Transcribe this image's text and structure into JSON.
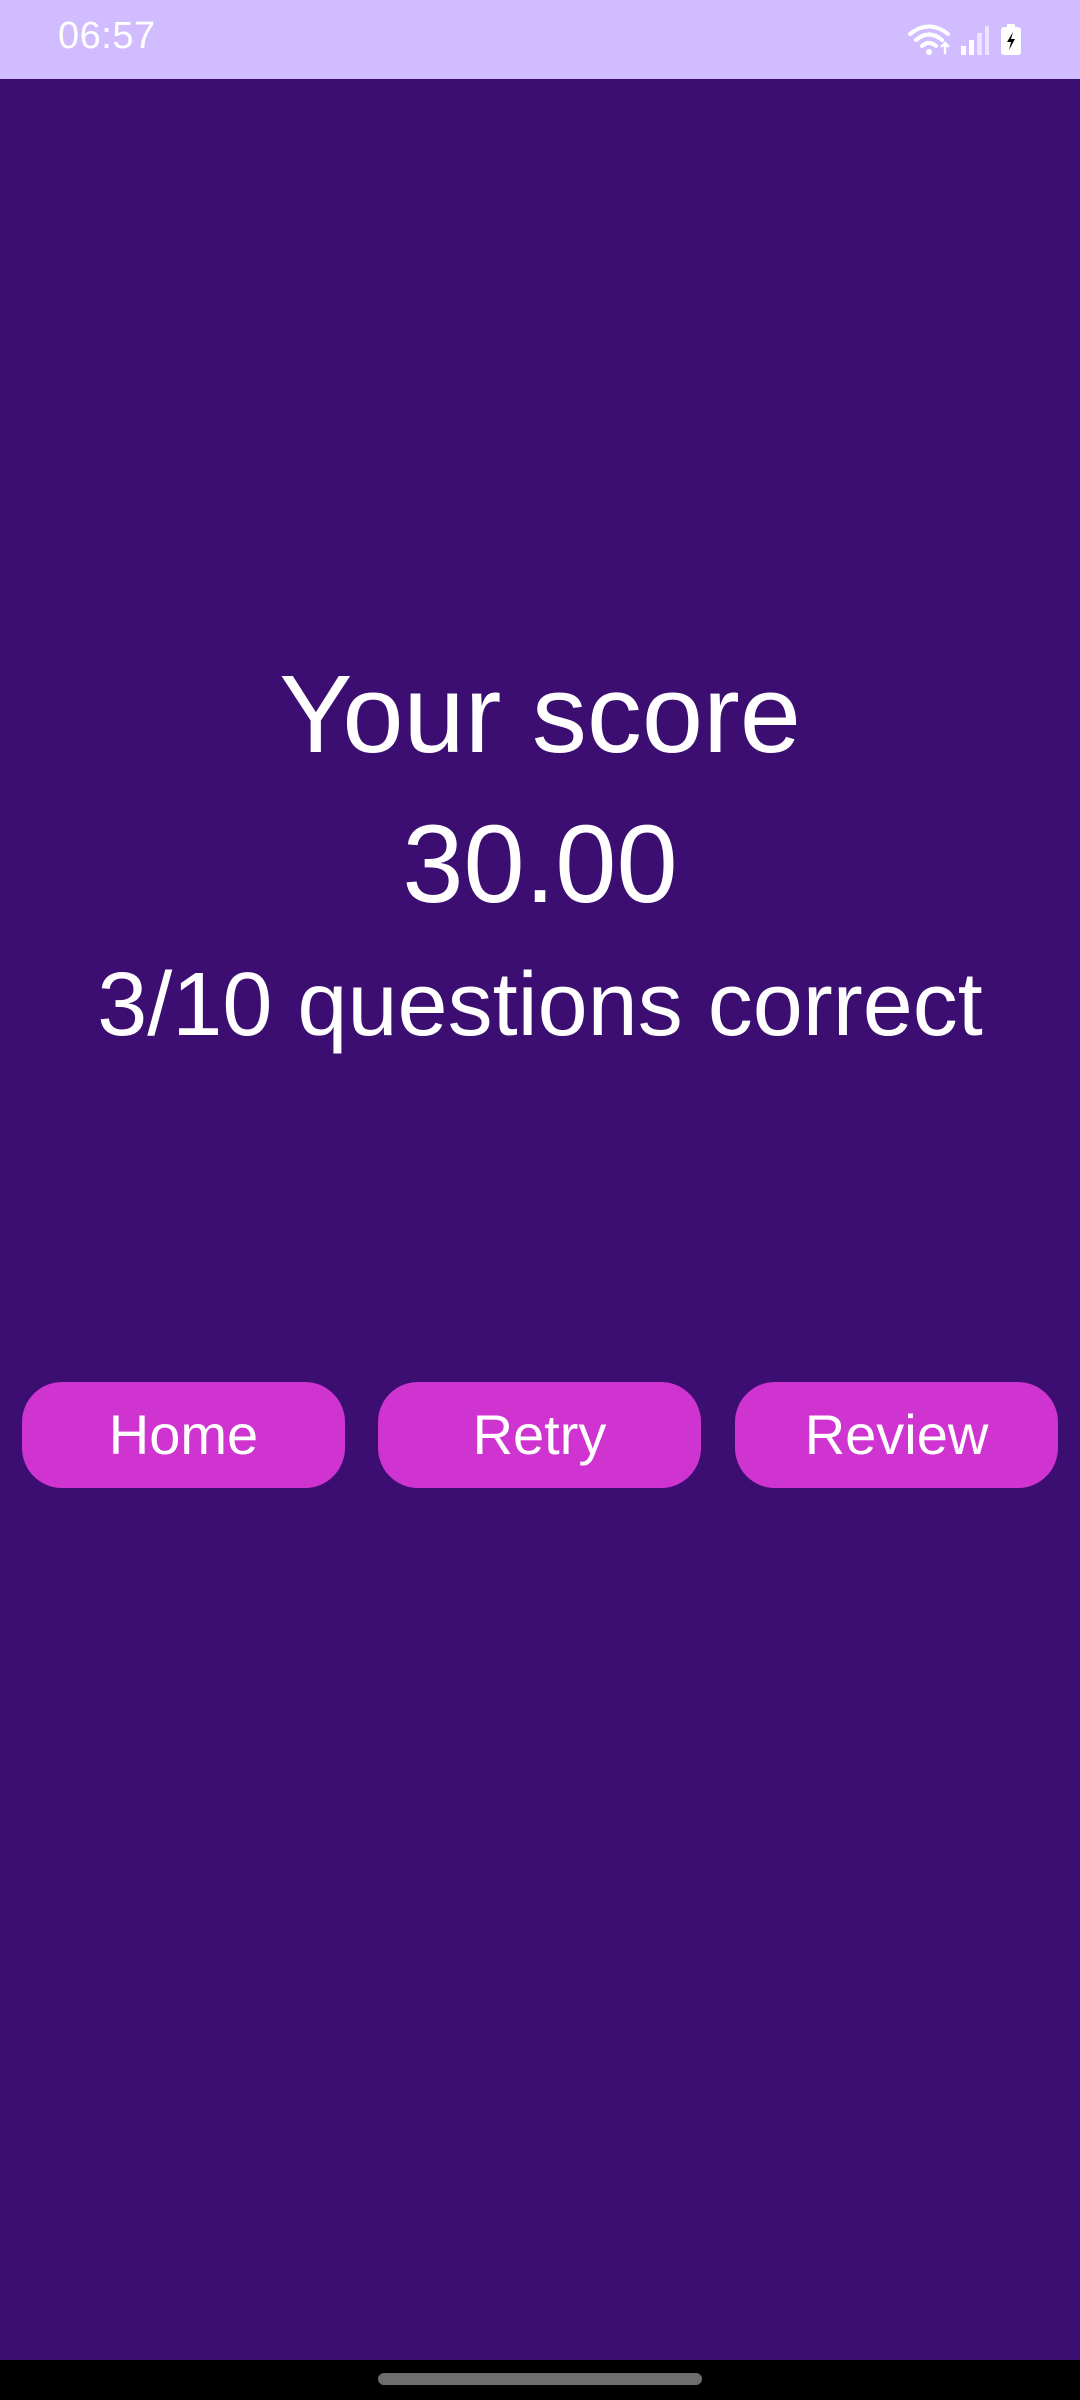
{
  "status_bar": {
    "time": "06:57",
    "icons": [
      "wifi-icon",
      "signal-icon",
      "battery-charging-icon"
    ]
  },
  "result": {
    "title": "Your score",
    "score": "30.00",
    "detail": "3/10 questions correct"
  },
  "actions": {
    "home_label": "Home",
    "retry_label": "Retry",
    "review_label": "Review"
  },
  "colors": {
    "background": "#3c0e72",
    "status_bar": "#d0bcff",
    "button": "#d034d0",
    "text": "#ffffff"
  }
}
